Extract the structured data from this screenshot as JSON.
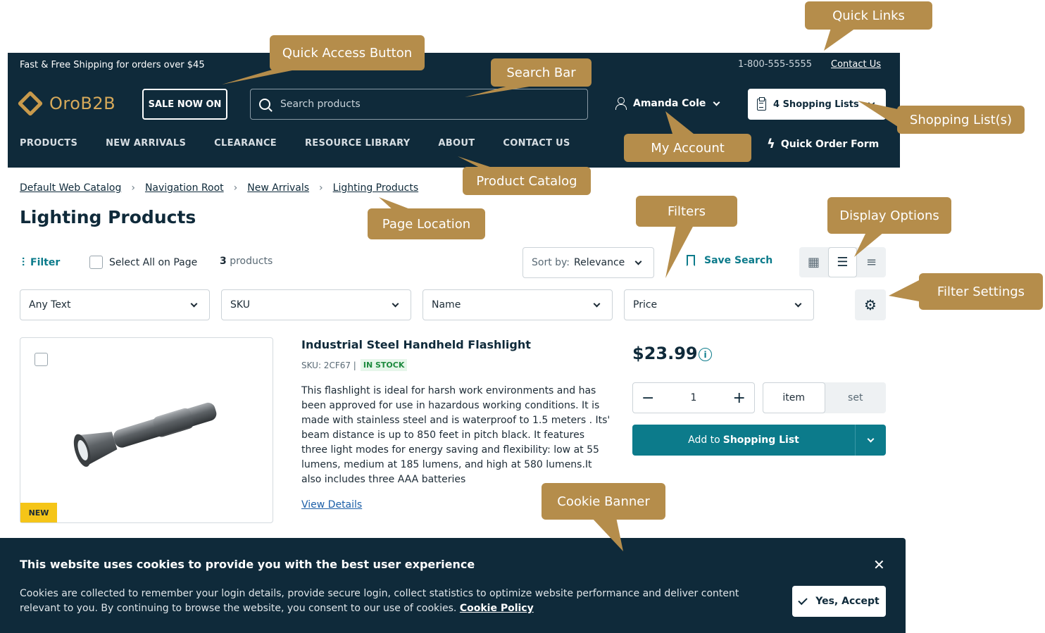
{
  "header": {
    "promo": "Fast & Free Shipping for orders over $45",
    "phone": "1-800-555-5555",
    "contact_link": "Contact Us",
    "logo_text": "OroB2B",
    "sale_button": "SALE NOW ON",
    "search_placeholder": "Search products",
    "account_name": "Amanda Cole",
    "shopping_lists": "4 Shopping Lists",
    "nav": [
      "PRODUCTS",
      "NEW ARRIVALS",
      "CLEARANCE",
      "RESOURCE LIBRARY",
      "ABOUT",
      "CONTACT US"
    ],
    "quick_order": "Quick Order Form"
  },
  "breadcrumb": [
    "Default Web Catalog",
    "Navigation Root",
    "New Arrivals",
    "Lighting Products"
  ],
  "page_title": "Lighting Products",
  "toolbar": {
    "filter": "Filter",
    "select_all": "Select All on Page",
    "count": "3",
    "count_label": "products",
    "sort_label": "Sort by:",
    "sort_value": "Relevance",
    "save_search": "Save Search"
  },
  "filters": [
    "Any Text",
    "SKU",
    "Name",
    "Price"
  ],
  "product": {
    "name": "Industrial Steel Handheld Flashlight",
    "sku": "SKU: 2CF67 |",
    "stock": "IN STOCK",
    "description": "This flashlight is ideal for harsh work environments and has been approved for use in hazardous working conditions. It is made with stainless steel and is waterproof to 1.5 meters . Its' beam distance is up to 850 feet in pitch black. It features three light modes for energy saving and flexibility: low at 55 lumens, medium at 185 lumens, and high at 580 lumens.It also includes three AAA batteries",
    "view_details": "View Details",
    "badge": "NEW",
    "price": "$23.99",
    "quantity": "1",
    "units": [
      "item",
      "set"
    ],
    "add_button_prefix": "Add to",
    "add_button_bold": "Shopping List"
  },
  "cookie": {
    "title": "This website uses cookies to provide you with the best user experience",
    "text": "Cookies are collected to remember your login details, provide secure login, collect statistics to optimize website performance and deliver content relevant to you. By continuing to browse the website, you consent to our use of cookies.",
    "policy_link": "Cookie Policy",
    "accept": "Yes, Accept"
  },
  "callouts": {
    "quick_links": "Quick Links",
    "quick_access": "Quick Access Button",
    "search_bar": "Search Bar",
    "shopping_lists": "Shopping List(s)",
    "my_account": "My Account",
    "product_catalog": "Product Catalog",
    "page_location": "Page Location",
    "filters": "Filters",
    "display_options": "Display Options",
    "filter_settings": "Filter Settings",
    "cookie_banner": "Cookie Banner"
  },
  "colors": {
    "header_bg": "#0f2a3a",
    "accent": "#0c7b8b",
    "callout": "#b58d4b",
    "badge": "#f5c518"
  }
}
